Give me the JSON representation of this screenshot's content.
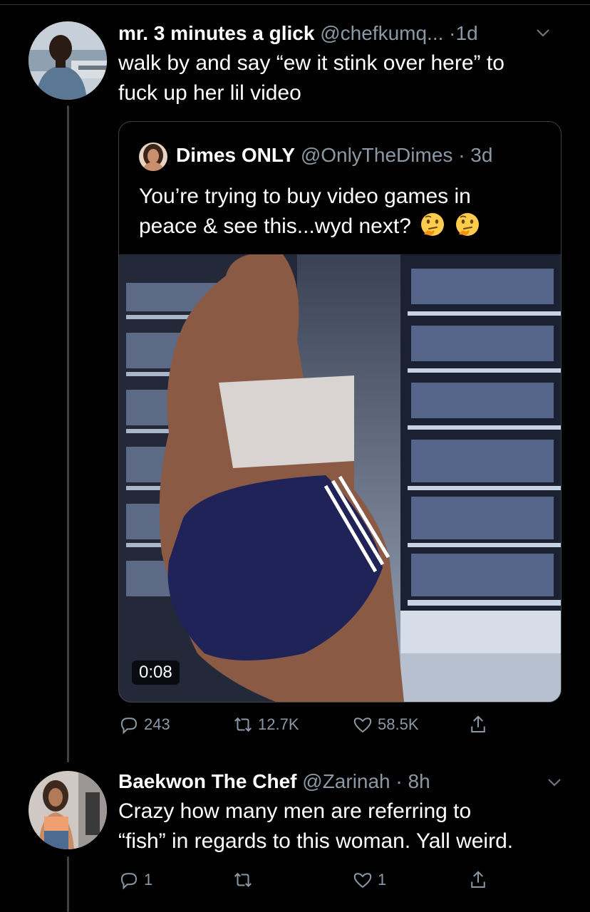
{
  "tweet1": {
    "display_name": "mr. 3 minutes a glick",
    "handle": "@chefkumq...",
    "dot": "·",
    "time": "1d",
    "text_line1": "walk by and say “ew it stink over here” to",
    "text_line2": "fuck up her lil video",
    "avatar_icon": "profile-photo-man-icon",
    "quoted": {
      "display_name": "Dimes ONLY",
      "handle": "@OnlyTheDimes",
      "time": "· 3d",
      "text_line1": "You’re trying to buy video games in",
      "text_line2": "peace & see this...wyd next?",
      "emoji_icon": "thinking-face-icon",
      "video_duration": "0:08"
    },
    "stats": {
      "replies": "243",
      "retweets": "12.7K",
      "likes": "58.5K"
    }
  },
  "tweet2": {
    "display_name": "Baekwon The Chef",
    "handle": "@Zarinah",
    "time": "· 8h",
    "text_line1": "Crazy how many men are referring to",
    "text_line2": "“fish” in regards to this woman. Yall weird.",
    "avatar_icon": "profile-photo-woman-icon",
    "stats": {
      "replies": "1",
      "retweets": "",
      "likes": "1"
    }
  },
  "colors": {
    "background": "#000000",
    "secondary_text": "#8b98a5",
    "border": "#3d4146"
  }
}
